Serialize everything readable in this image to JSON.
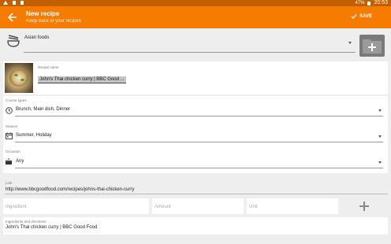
{
  "status_bar": {
    "battery": "47%",
    "time": "20:53"
  },
  "app_bar": {
    "title": "New recipe",
    "subtitle": "Keep track of your recipes",
    "save_label": "SAVE"
  },
  "category": {
    "value": "Asian foods"
  },
  "recipe_name": {
    "label": "Recipe name",
    "value": "John's Thai chicken curry | BBC Good ..."
  },
  "course_types": {
    "label": "Course types",
    "value": "Brunch, Main dish, Dinner"
  },
  "season": {
    "label": "Season",
    "value": "Summer, Holiday"
  },
  "occasion": {
    "label": "Occasion",
    "value": "Any"
  },
  "link": {
    "label": "Link",
    "value": "http://www.bbcgoodfood.com/recipes/johns-thai-chicken-curry"
  },
  "ingredient_inputs": {
    "ingredient_placeholder": "Ingredient",
    "amount_placeholder": "Amount",
    "unit_placeholder": "Unit"
  },
  "ingredients_directions": {
    "label": "Ingredients and directions",
    "value": "John's Thai chicken curry | BBC Good Food"
  },
  "colors": {
    "app_bar": "#f57c00",
    "status_bar": "#c25f00"
  }
}
